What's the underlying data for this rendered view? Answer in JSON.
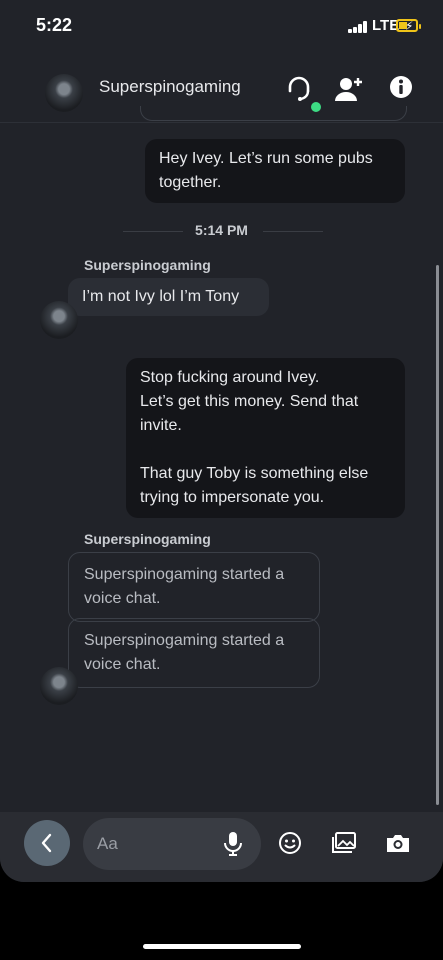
{
  "status": {
    "time": "5:22",
    "network": "LTE"
  },
  "header": {
    "contact_name": "Superspinogaming"
  },
  "messages": {
    "out1": "Hey Ivey. Let’s run some pubs together.",
    "time_separator": "5:14 PM",
    "sender1": "Superspinogaming",
    "in1": "I’m not Ivy lol I’m Tony",
    "out2": "Stop fucking around Ivey.\nLet’s get this money. Send that invite.\n\nThat guy Toby is something else trying to impersonate you.",
    "sender2": "Superspinogaming",
    "sys1": "Superspinogaming started a voice chat.",
    "sys2": "Superspinogaming started a voice chat."
  },
  "composer": {
    "placeholder": "Aa"
  },
  "colors": {
    "background": "#212329",
    "bubble_outgoing": "#141519",
    "bubble_incoming": "#2b2e35",
    "presence": "#3ddc84",
    "battery": "#f0c419"
  }
}
